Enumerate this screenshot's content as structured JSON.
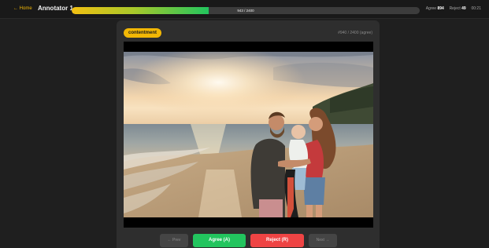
{
  "header": {
    "home_link": "← Home",
    "annotator_name": "Annotator 1"
  },
  "progress": {
    "label": "943 / 2400",
    "fraction": 0.393
  },
  "stats": {
    "agree_label": "Agree",
    "agree_value": "894",
    "reject_label": "Reject",
    "reject_value": "49",
    "timer": "00:21"
  },
  "item": {
    "emotion_tag": "contentment",
    "meta": "#940 / 2400 (agree)"
  },
  "buttons": {
    "prev": "← Prev",
    "agree": "Agree (A)",
    "reject": "Reject (R)",
    "next": "Next →"
  },
  "colors": {
    "accent": "#f2b705",
    "agree": "#22c55e",
    "reject": "#ef4444"
  }
}
